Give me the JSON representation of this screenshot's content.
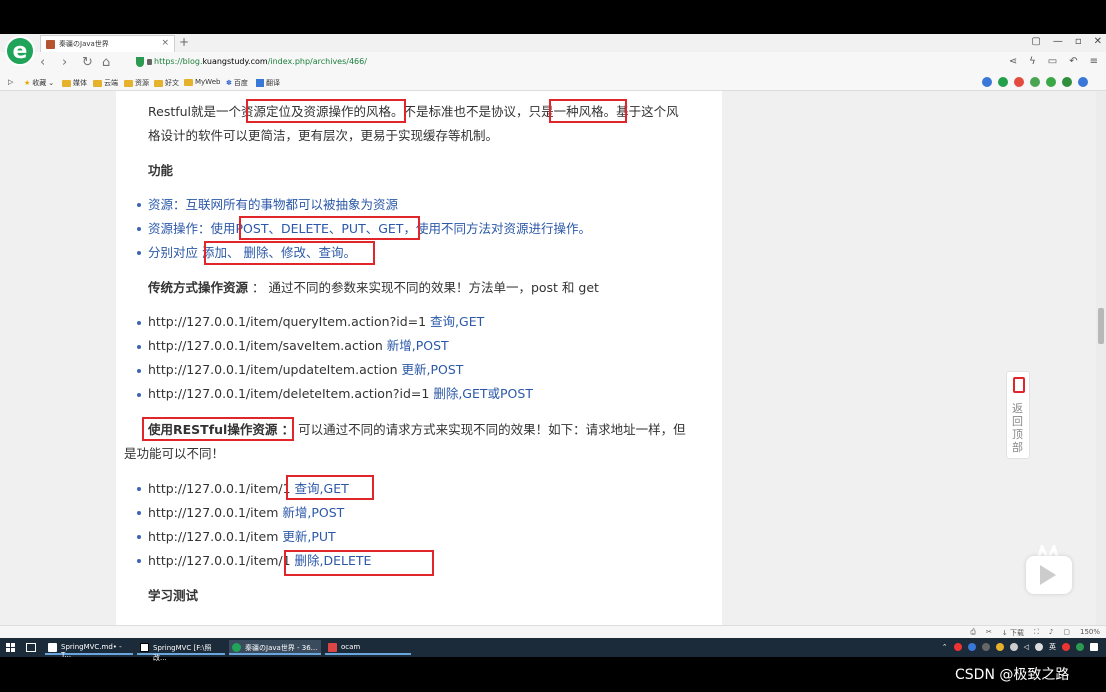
{
  "browser": {
    "tab_title": "秦疆のJava世界",
    "new_tab_symbol": "+",
    "tab_close_symbol": "×",
    "url_prefix": "https://blog.",
    "url_domain": "kuangstudy.com",
    "url_path": "/index.php/archives/466/",
    "window_controls": [
      "▢",
      "—",
      "▫",
      "✕"
    ],
    "bookmarks": [
      "收藏",
      "媒体",
      "云端",
      "资源",
      "好文",
      "MyWeb",
      "百度",
      "翻译"
    ]
  },
  "article": {
    "intro_line1_a": "Restful就是一个",
    "intro_line1_b": "资源定位及资源操作的风格",
    "intro_line1_c": "。不是标准也不是协议，",
    "intro_line1_d": "只是一种风格",
    "intro_line1_e": "。基于这个风",
    "intro_line2": "格设计的软件可以更简洁，更有层次，更易于实现缓存等机制。",
    "section_function": "功能",
    "function_items": [
      {
        "label": "资源：互联网所有的事物都可以被抽象为资源",
        "highlight": "",
        "rest": ""
      },
      {
        "label": "资源操作：使用",
        "highlight": "POST、DELETE、PUT、GET",
        "rest": "，使用不同方法对资源进行操作。"
      },
      {
        "label": "分别对应 ",
        "highlight": "添加、 删除、修改、查询。",
        "rest": ""
      }
    ],
    "traditional_title": "传统方式操作资源",
    "traditional_desc": " ： 通过不同的参数来实现不同的效果！方法单一，post 和 get",
    "traditional_items": [
      {
        "url": "http://127.0.0.1/item/queryItem.action?id=1 ",
        "method": "查询,GET"
      },
      {
        "url": "http://127.0.0.1/item/saveItem.action ",
        "method": "新增,POST"
      },
      {
        "url": "http://127.0.0.1/item/updateItem.action ",
        "method": "更新,POST"
      },
      {
        "url": "http://127.0.0.1/item/deleteItem.action?id=1 ",
        "method": "删除,GET或POST"
      }
    ],
    "restful_title": "使用RESTful操作资源 ：",
    "restful_desc_line1": " 可以通过不同的请求方式来实现不同的效果！如下：请求地址一样，但",
    "restful_desc_line2": "是功能可以不同！",
    "restful_items": [
      {
        "url": "http://127.0.0.1/item",
        "suffix": "/1 ",
        "method": "查询,GET"
      },
      {
        "url": "http://127.0.0.1/item ",
        "suffix": "",
        "method": "新增,POST"
      },
      {
        "url": "http://127.0.0.1/item ",
        "suffix": "",
        "method": "更新,PUT"
      },
      {
        "url": "http://127.0.0.1/item",
        "suffix": "/1 ",
        "method": "删除,DELETE"
      }
    ],
    "next_section": "学习测试"
  },
  "widgets": {
    "back_to_top": "返回顶部"
  },
  "statusbar": {
    "download": "下载",
    "zoom": "150%"
  },
  "taskbar": {
    "tasks": [
      "SpringMVC.md• - T...",
      "SpringMVC [F:\\照改...",
      "秦疆のJava世界 - 36...",
      "ocam"
    ],
    "tray_lang": "英"
  },
  "watermark": "CSDN @极致之路",
  "colors": {
    "highlight_box": "#e0262b",
    "link_blue": "#2b58a8",
    "bullet": "#3c64b5"
  }
}
